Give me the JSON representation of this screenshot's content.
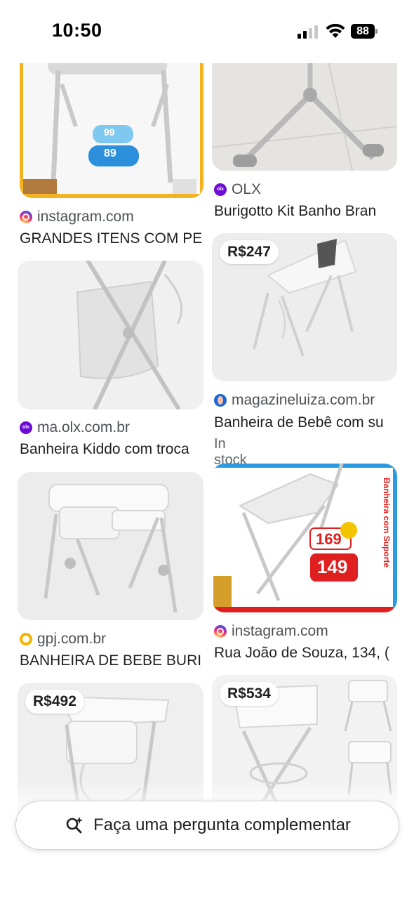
{
  "status_bar": {
    "time": "10:50",
    "battery": "88"
  },
  "results": [
    {
      "id": "r1",
      "source": "instagram.com",
      "title": "GRANDES ITENS COM PE"
    },
    {
      "id": "r2",
      "source": "OLX",
      "title": "Burigotto Kit Banho Bran"
    },
    {
      "id": "r3",
      "source": "ma.olx.com.br",
      "title": "Banheira Kiddo com troca"
    },
    {
      "id": "r4",
      "price": "R$247",
      "source": "magazineluiza.com.br",
      "title": "Banheira de Bebê com su",
      "stock": "In stock"
    },
    {
      "id": "r5",
      "source": "gpj.com.br",
      "title": "BANHEIRA DE BEBE BURI"
    },
    {
      "id": "r6",
      "source": "instagram.com",
      "title": "Rua João de Souza, 134, (",
      "image_text": {
        "price_old": "169",
        "price_new": "149",
        "vertical": "Banheira com Suporte"
      }
    },
    {
      "id": "r7",
      "price": "R$492"
    },
    {
      "id": "r8",
      "price": "R$534"
    }
  ],
  "image_text": {
    "r1_price_a": "99",
    "r1_price_b": "89",
    "olx_logo": "olx"
  },
  "follow_up": {
    "label": "Faça uma pergunta complementar",
    "icon": "sparkle-search-icon"
  },
  "colors": {
    "accent": "#1a73e8",
    "instagram": "#d6249f",
    "olx": "#6e0ad6",
    "price_red": "#e02020"
  }
}
